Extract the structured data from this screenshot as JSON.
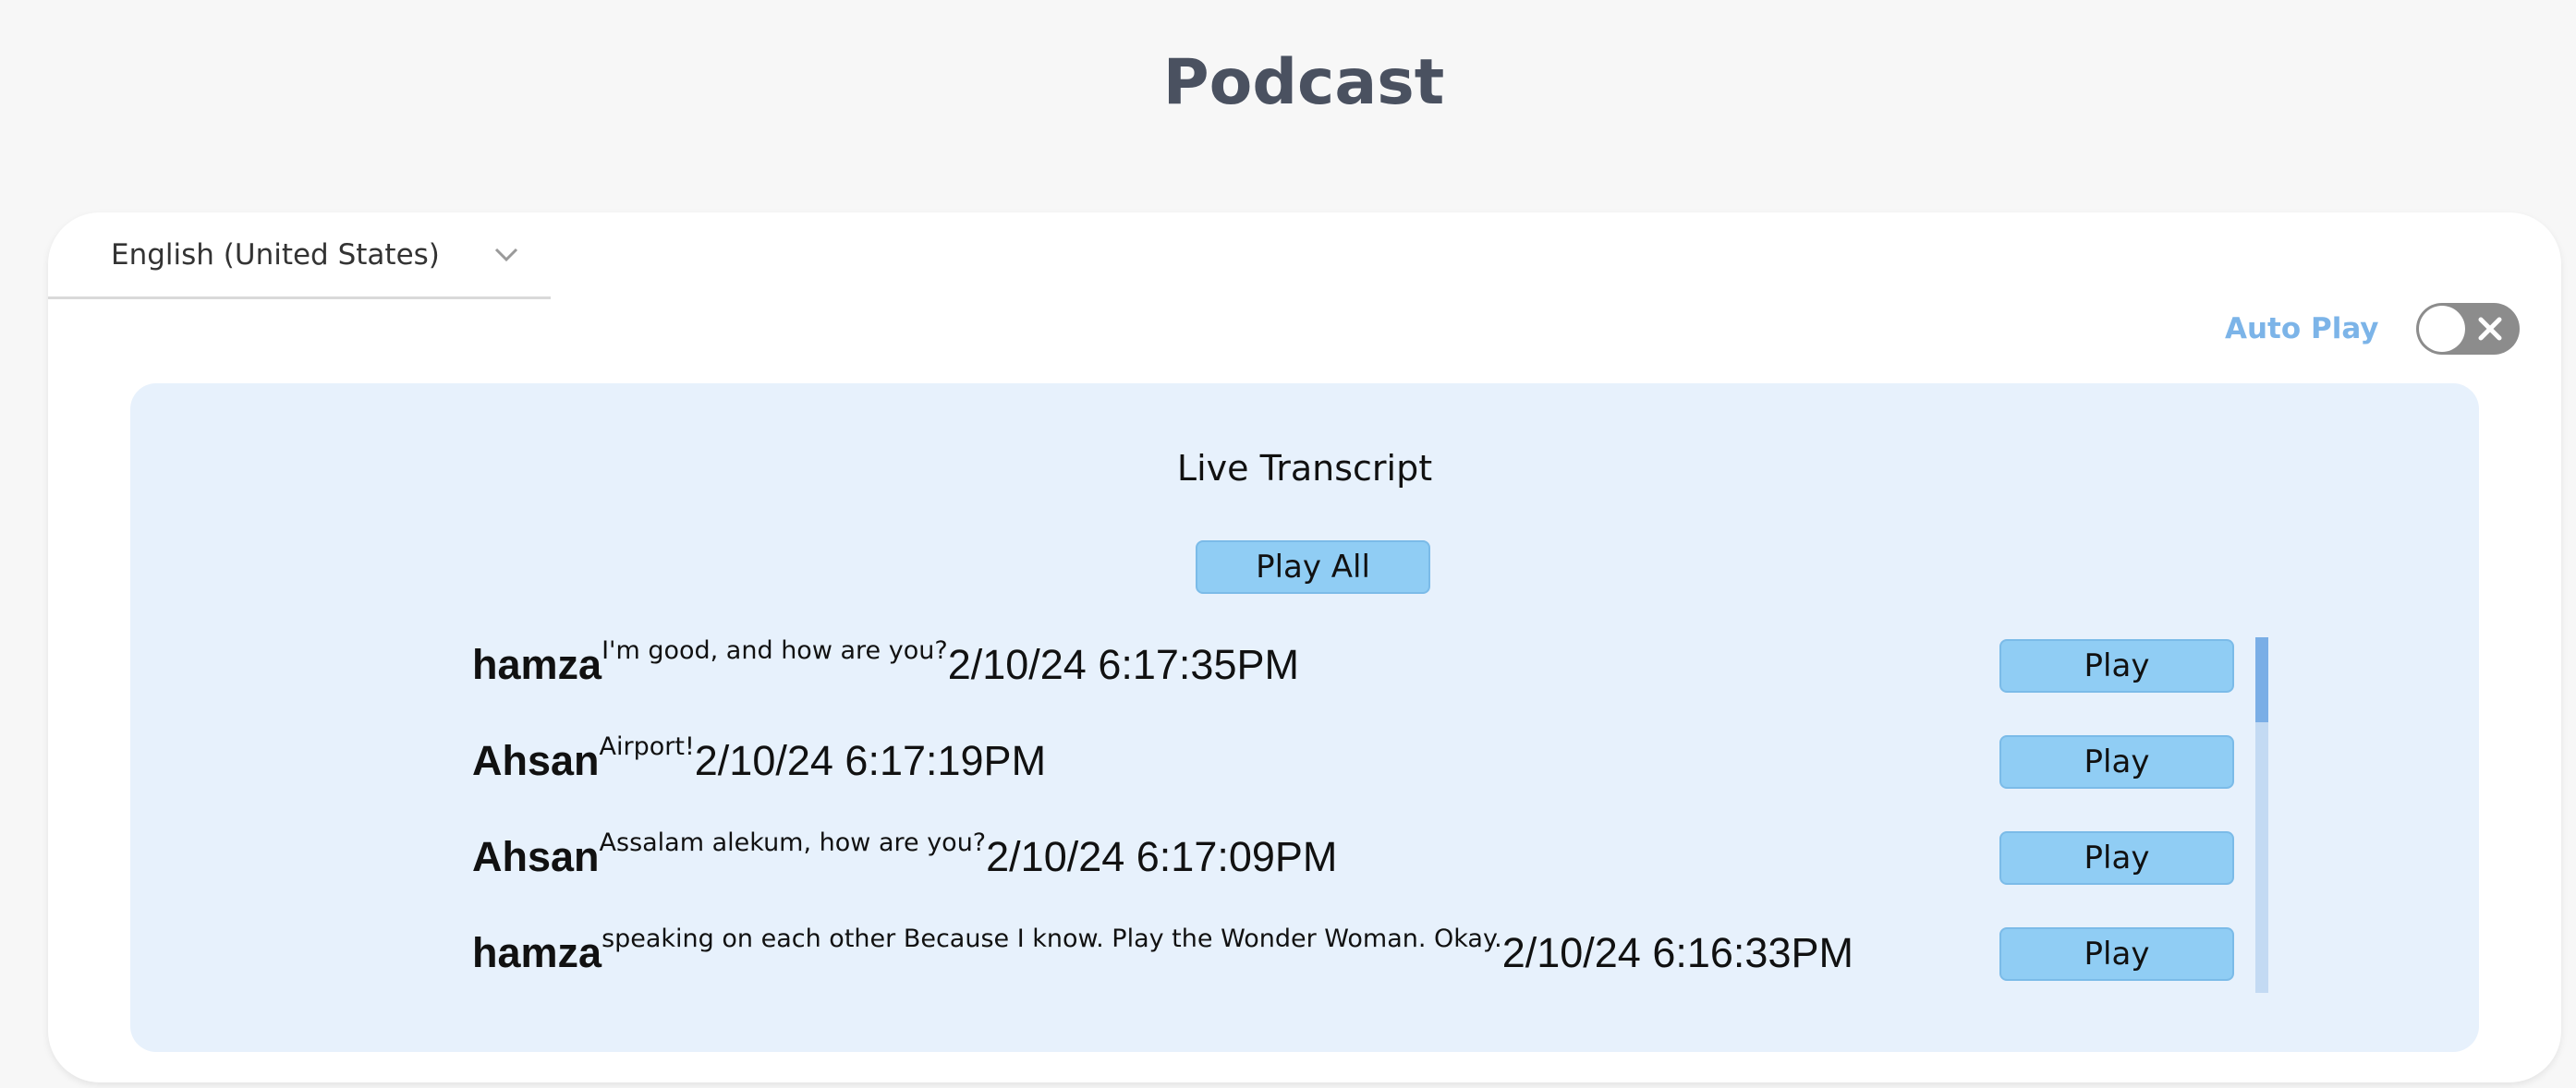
{
  "page": {
    "title": "Podcast"
  },
  "language": {
    "selected": "English (United States)"
  },
  "autoplay": {
    "label": "Auto Play",
    "enabled": false
  },
  "transcript": {
    "title": "Live Transcript",
    "play_all_label": "Play All",
    "entries": [
      {
        "speaker": "hamza",
        "text": "I'm good, and how are you?",
        "timestamp": "2/10/24 6:17:35PM",
        "play_label": "Play"
      },
      {
        "speaker": "Ahsan",
        "text": "Airport!",
        "timestamp": "2/10/24 6:17:19PM",
        "play_label": "Play"
      },
      {
        "speaker": "Ahsan",
        "text": "Assalam alekum, how are you?",
        "timestamp": "2/10/24 6:17:09PM",
        "play_label": "Play"
      },
      {
        "speaker": "hamza",
        "text": "speaking on each other Because I know. Play the Wonder Woman. Okay.",
        "timestamp": "2/10/24 6:16:33PM",
        "play_label": "Play"
      }
    ]
  },
  "colors": {
    "accent": "#7cb4e8",
    "button": "#90cdf4",
    "panel": "#e7f1fc",
    "toggle_off": "#8c8c8c"
  },
  "icons": {
    "dropdown": "chevron-down-icon",
    "toggle": "close-icon"
  }
}
